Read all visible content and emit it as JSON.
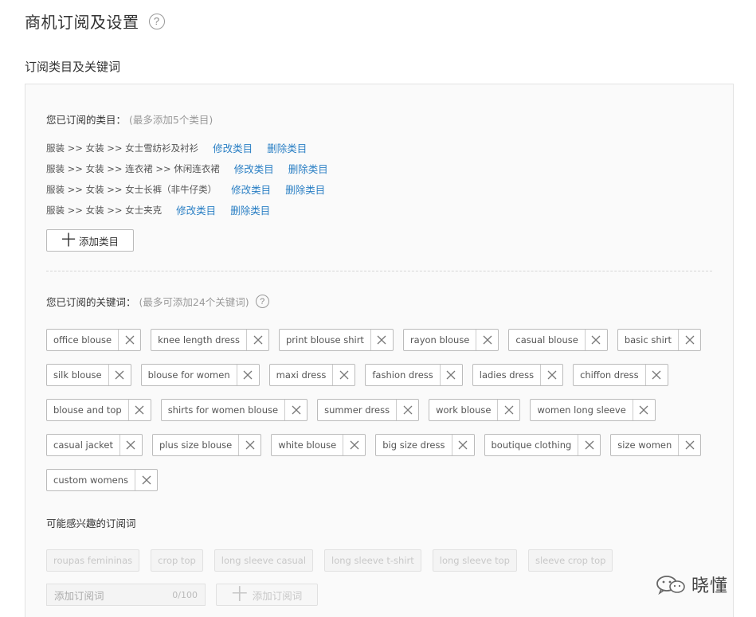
{
  "page": {
    "title": "商机订阅及设置",
    "help_icon": "?"
  },
  "section": {
    "title": "订阅类目及关键词"
  },
  "categories": {
    "label": "您已订阅的类目：",
    "note": "(最多添加5个类目)",
    "items": [
      {
        "path": "服装 >> 女装 >> 女士雪纺衫及衬衫",
        "edit": "修改类目",
        "delete": "删除类目"
      },
      {
        "path": "服装 >> 女装 >> 连衣裙 >> 休闲连衣裙",
        "edit": "修改类目",
        "delete": "删除类目"
      },
      {
        "path": "服装 >> 女装 >> 女士长裤（非牛仔类）",
        "edit": "修改类目",
        "delete": "删除类目"
      },
      {
        "path": "服装 >> 女装 >> 女士夹克",
        "edit": "修改类目",
        "delete": "删除类目"
      }
    ],
    "add_button": "添加类目",
    "add_icon": "十"
  },
  "keywords": {
    "label": "您已订阅的关键词：",
    "note": "(最多可添加24个关键词)",
    "help_icon": "?",
    "rows": [
      [
        "office blouse",
        "knee length dress",
        "print blouse shirt",
        "rayon blouse",
        "casual blouse",
        "basic shirt"
      ],
      [
        "silk blouse",
        "blouse for women",
        "maxi dress",
        "fashion dress",
        "ladies dress",
        "chiffon dress"
      ],
      [
        "blouse and top",
        "shirts for women blouse",
        "summer dress",
        "work blouse",
        "women long sleeve"
      ],
      [
        "casual jacket",
        "plus size blouse",
        "white blouse",
        "big size dress",
        "boutique clothing",
        "size women"
      ],
      [
        "custom womens"
      ]
    ]
  },
  "suggestions": {
    "label": "可能感兴趣的订阅词",
    "items": [
      "roupas femininas",
      "crop top",
      "long sleeve casual",
      "long sleeve t-shirt",
      "long sleeve top",
      "sleeve crop top"
    ]
  },
  "add_keyword": {
    "placeholder": "添加订阅词",
    "count": "0/100",
    "button": "添加订阅词",
    "button_icon": "十"
  },
  "watermark": {
    "text": "晓懂"
  },
  "colors": {
    "link": "#2a7fc4",
    "panel_bg": "#fafafa",
    "border": "#e2e2e2"
  }
}
